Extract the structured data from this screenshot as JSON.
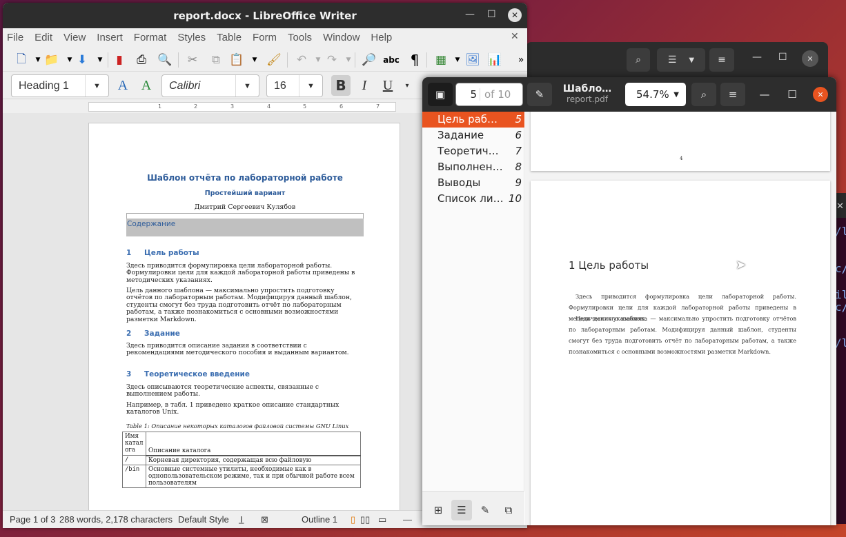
{
  "background_terminal": {
    "lines": [
      "/l",
      "c/",
      "il",
      "c/",
      "/l"
    ]
  },
  "files_window": {},
  "writer": {
    "title": "report.docx - LibreOffice Writer",
    "menu": [
      "File",
      "Edit",
      "View",
      "Insert",
      "Format",
      "Styles",
      "Table",
      "Form",
      "Tools",
      "Window",
      "Help"
    ],
    "paragraph_style": "Heading 1",
    "font_name": "Calibri",
    "font_size": "16",
    "ruler_numbers": [
      "1",
      "2",
      "3",
      "4",
      "5",
      "6",
      "7"
    ],
    "doc": {
      "title": "Шаблон отчёта по лабораторной работе",
      "subtitle": "Простейший вариант",
      "author": "Дмитрий Сергеевич Кулябов",
      "toc_label": "Содержание",
      "s1_num": "1",
      "s1_title": "Цель работы",
      "s1_p1": "Здесь приводится формулировка цели лабораторной работы. Формулировки цели для каждой лабораторной работы приведены в методических указаниях.",
      "s1_p2": "Цель данного шаблона — максимально упростить подготовку отчётов по лабораторным работам. Модифицируя данный шаблон, студенты смогут без труда подготовить отчёт по лабораторным работам, а также познакомиться с основными возможностями разметки Markdown.",
      "s2_num": "2",
      "s2_title": "Задание",
      "s2_p1": "Здесь приводится описание задания в соответствии с рекомендациями методического пособия и выданным вариантом.",
      "s3_num": "3",
      "s3_title": "Теоретическое введение",
      "s3_p1": "Здесь описываются теоретические аспекты, связанные с выполнением работы.",
      "s3_p2": "Например, в табл. 1 приведено краткое описание стандартных каталогов Unix.",
      "caption": "Table 1: Описание некоторых каталогов файловой системы GNU Linux",
      "table": {
        "h1": "Имя катал ога",
        "h2": "Описание каталога",
        "r1c1": "/",
        "r1c2": "Корневая директория, содержащая всю файловую",
        "r2c1": "/bin",
        "r2c2": "Основные системные утилиты, необходимые как в однопользовательском режиме, так и при обычной работе всем пользователям"
      }
    },
    "status": {
      "page": "Page 1 of 3",
      "words": "288 words, 2,178 characters",
      "style": "Default Style",
      "outline": "Outline 1"
    }
  },
  "pdf": {
    "page_number": "5",
    "page_total": "of 10",
    "title": "Шабло…",
    "filename": "report.pdf",
    "zoom": "54.7%",
    "outline": [
      {
        "title": "Цель работы",
        "page": "5"
      },
      {
        "title": "Задание",
        "page": "6"
      },
      {
        "title": "Теоретичес…",
        "page": "7"
      },
      {
        "title": "Выполнени…",
        "page": "8"
      },
      {
        "title": "Выводы",
        "page": "9"
      },
      {
        "title": "Список лит…",
        "page": "10"
      }
    ],
    "prev_page_number": "4",
    "heading": "1  Цель работы",
    "para1": "Здесь приводится формулировка цели лабораторной работы. Формулировки цели для каждой лабораторной работы приведены в методических указаниях.",
    "para2": "Цель данного шаблона — максимально упростить подготовку отчётов по лабораторным работам. Модифицируя данный шаблон, студенты смогут без труда подготовить отчёт по лабораторным работам, а также познакомиться с основными возможностями разметки Markdown."
  }
}
